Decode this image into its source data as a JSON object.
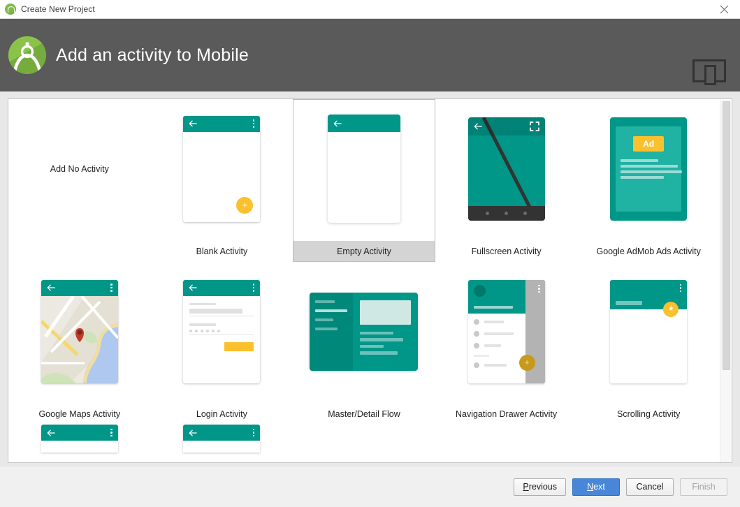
{
  "window": {
    "title": "Create New Project",
    "app_icon": "android-studio-icon",
    "close_icon": "close-icon"
  },
  "header": {
    "title": "Add an activity to Mobile",
    "logo_icon": "android-studio-logo",
    "form_factor_icon": "tablet-device-icon"
  },
  "activities": [
    {
      "label": "Add No Activity",
      "thumb": "none",
      "selected": false
    },
    {
      "label": "Blank Activity",
      "thumb": "blank",
      "selected": false
    },
    {
      "label": "Empty Activity",
      "thumb": "empty",
      "selected": true
    },
    {
      "label": "Fullscreen Activity",
      "thumb": "fullscreen",
      "selected": false
    },
    {
      "label": "Google AdMob Ads Activity",
      "thumb": "admob",
      "selected": false
    },
    {
      "label": "Google Maps Activity",
      "thumb": "maps",
      "selected": false
    },
    {
      "label": "Login Activity",
      "thumb": "login",
      "selected": false
    },
    {
      "label": "Master/Detail Flow",
      "thumb": "masterdetail",
      "selected": false
    },
    {
      "label": "Navigation Drawer Activity",
      "thumb": "navdrawer",
      "selected": false
    },
    {
      "label": "Scrolling Activity",
      "thumb": "scrolling",
      "selected": false
    }
  ],
  "thumb_text": {
    "ad_badge": "Ad",
    "fab_plus": "+",
    "fab_star": "★"
  },
  "scrollbar": {
    "name": "vertical-scrollbar"
  },
  "footer": {
    "previous": "Previous",
    "previous_mnemonic": "P",
    "previous_rest": "revious",
    "next": "Next",
    "next_mnemonic": "N",
    "next_rest": "ext",
    "cancel": "Cancel",
    "finish": "Finish"
  },
  "colors": {
    "teal": "#009688",
    "teal_dark": "#00796b",
    "amber": "#fbc02d",
    "header_gray": "#5a5a5a",
    "primary_button": "#4a86d8",
    "selection_gray": "#d4d4d4"
  }
}
